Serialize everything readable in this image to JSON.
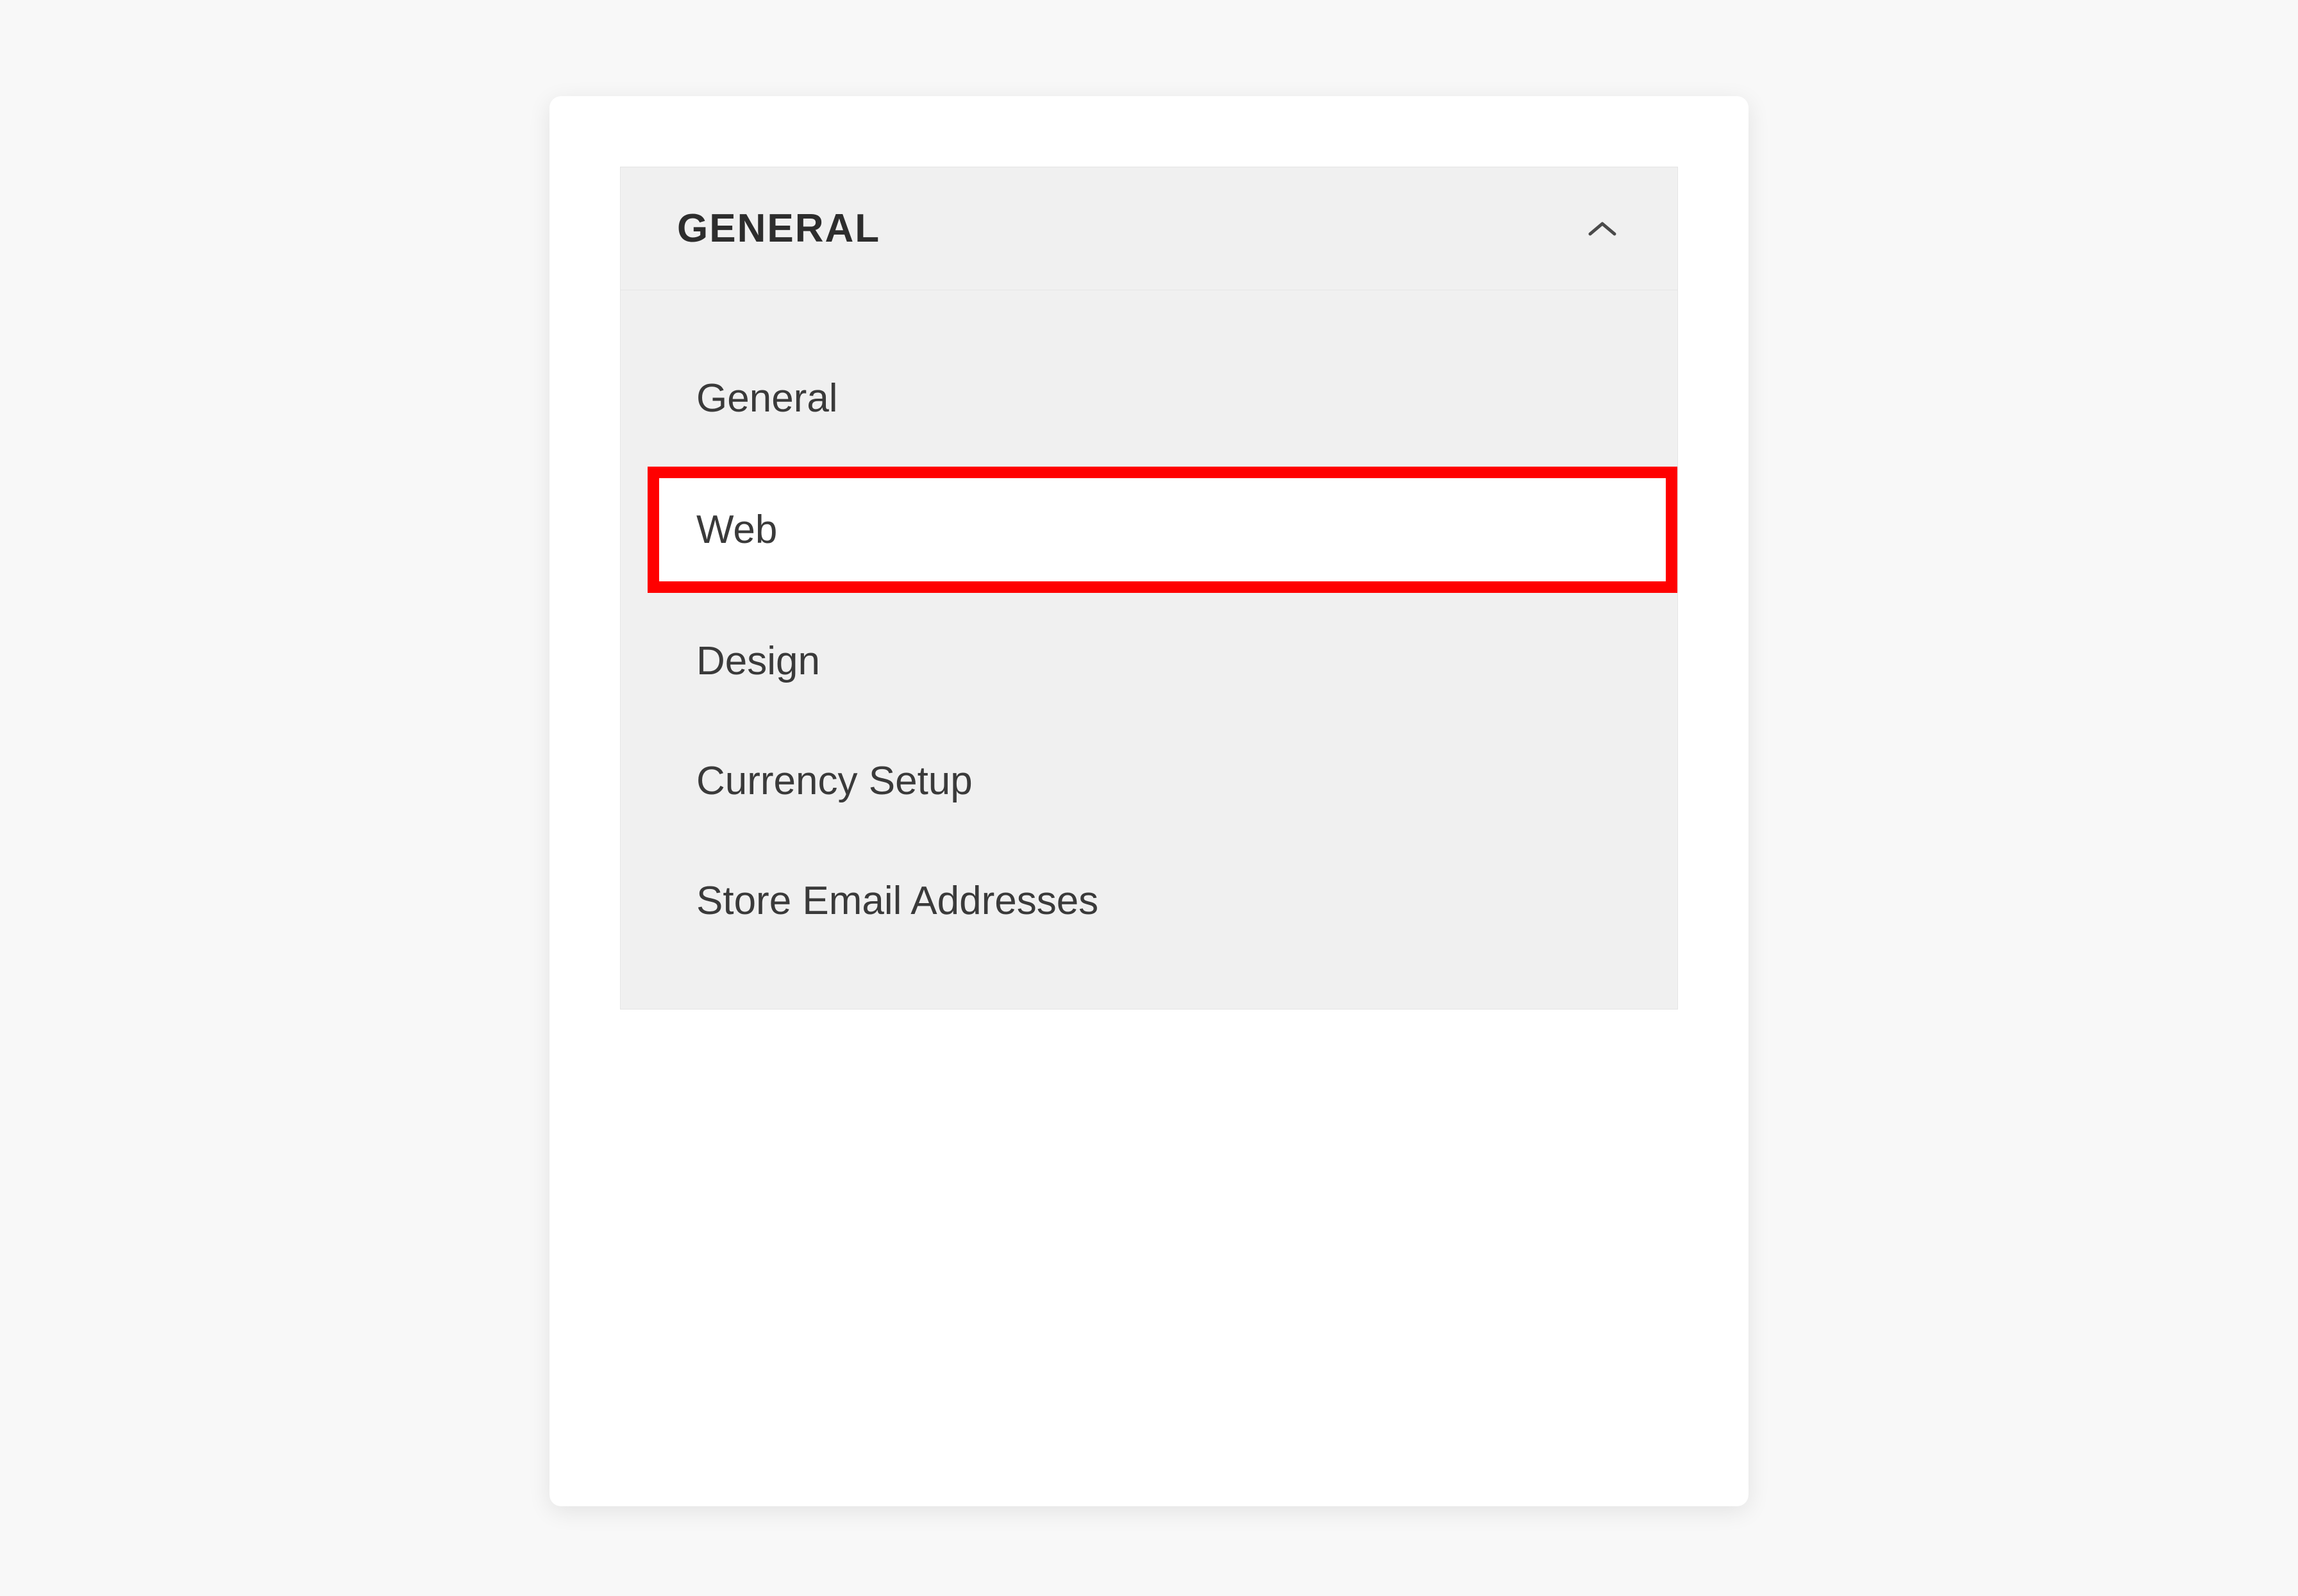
{
  "sidebar": {
    "section_title": "GENERAL",
    "expanded": true,
    "items": [
      {
        "label": "General",
        "active": false,
        "highlighted": false
      },
      {
        "label": "Web",
        "active": true,
        "highlighted": true
      },
      {
        "label": "Design",
        "active": false,
        "highlighted": false
      },
      {
        "label": "Currency Setup",
        "active": false,
        "highlighted": false
      },
      {
        "label": "Store Email Addresses",
        "active": false,
        "highlighted": false
      }
    ]
  },
  "colors": {
    "highlight": "#ff0000",
    "panel_bg": "#f0f0f0",
    "card_bg": "#ffffff",
    "text": "#3a3a3a"
  }
}
